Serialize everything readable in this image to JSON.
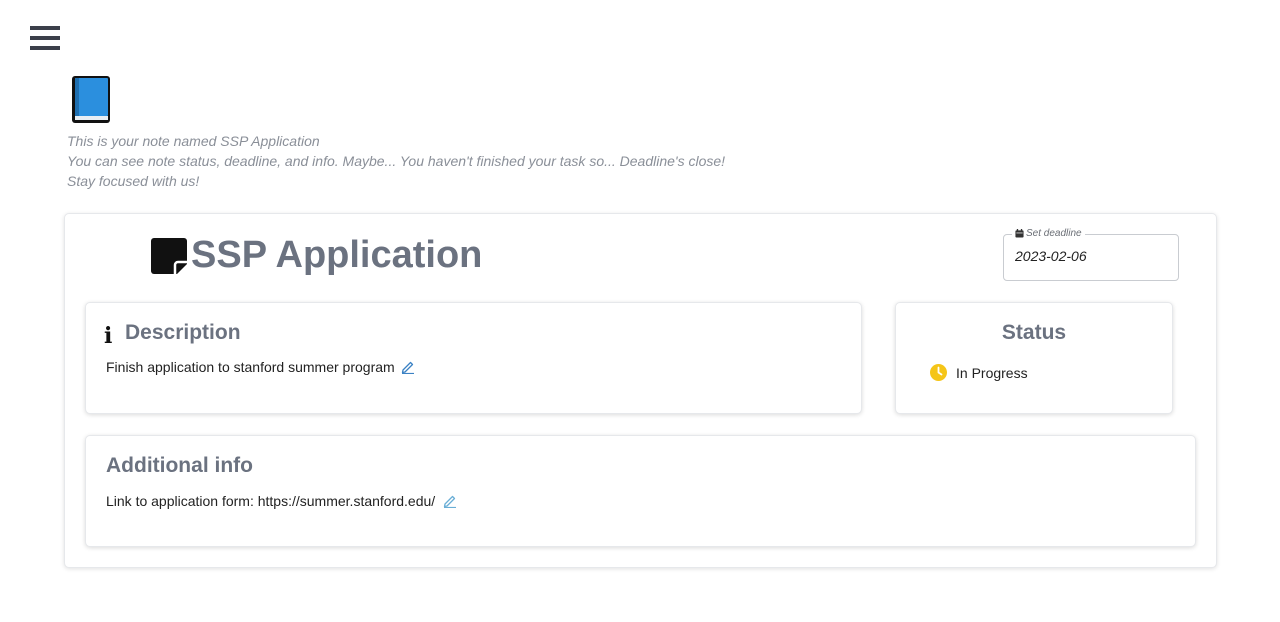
{
  "menu": {
    "icon": "hamburger-menu-icon"
  },
  "header_icon": "blue-book-icon",
  "intro": {
    "line1": "This is your note named SSP Application",
    "line2": "You can see note status, deadline, and info. Maybe... You haven't finished your task so... Deadline's close!",
    "line3": "Stay focused with us!"
  },
  "note": {
    "icon": "sticky-note-icon",
    "title": "SSP Application"
  },
  "deadline": {
    "label": "Set deadline",
    "icon": "calendar-icon",
    "value": "2023-02-06"
  },
  "description": {
    "heading": "Description",
    "icon": "info-icon",
    "text": "Finish application to stanford summer program"
  },
  "status": {
    "heading": "Status",
    "value": "In Progress",
    "icon": "clock-icon",
    "color": "#f5c518"
  },
  "additional_info": {
    "heading": "Additional info",
    "text": "Link to application form: https://summer.stanford.edu/"
  },
  "colors": {
    "heading": "#6b7280",
    "edit_icon": "#3b82c4",
    "book": "#2b8fde"
  }
}
